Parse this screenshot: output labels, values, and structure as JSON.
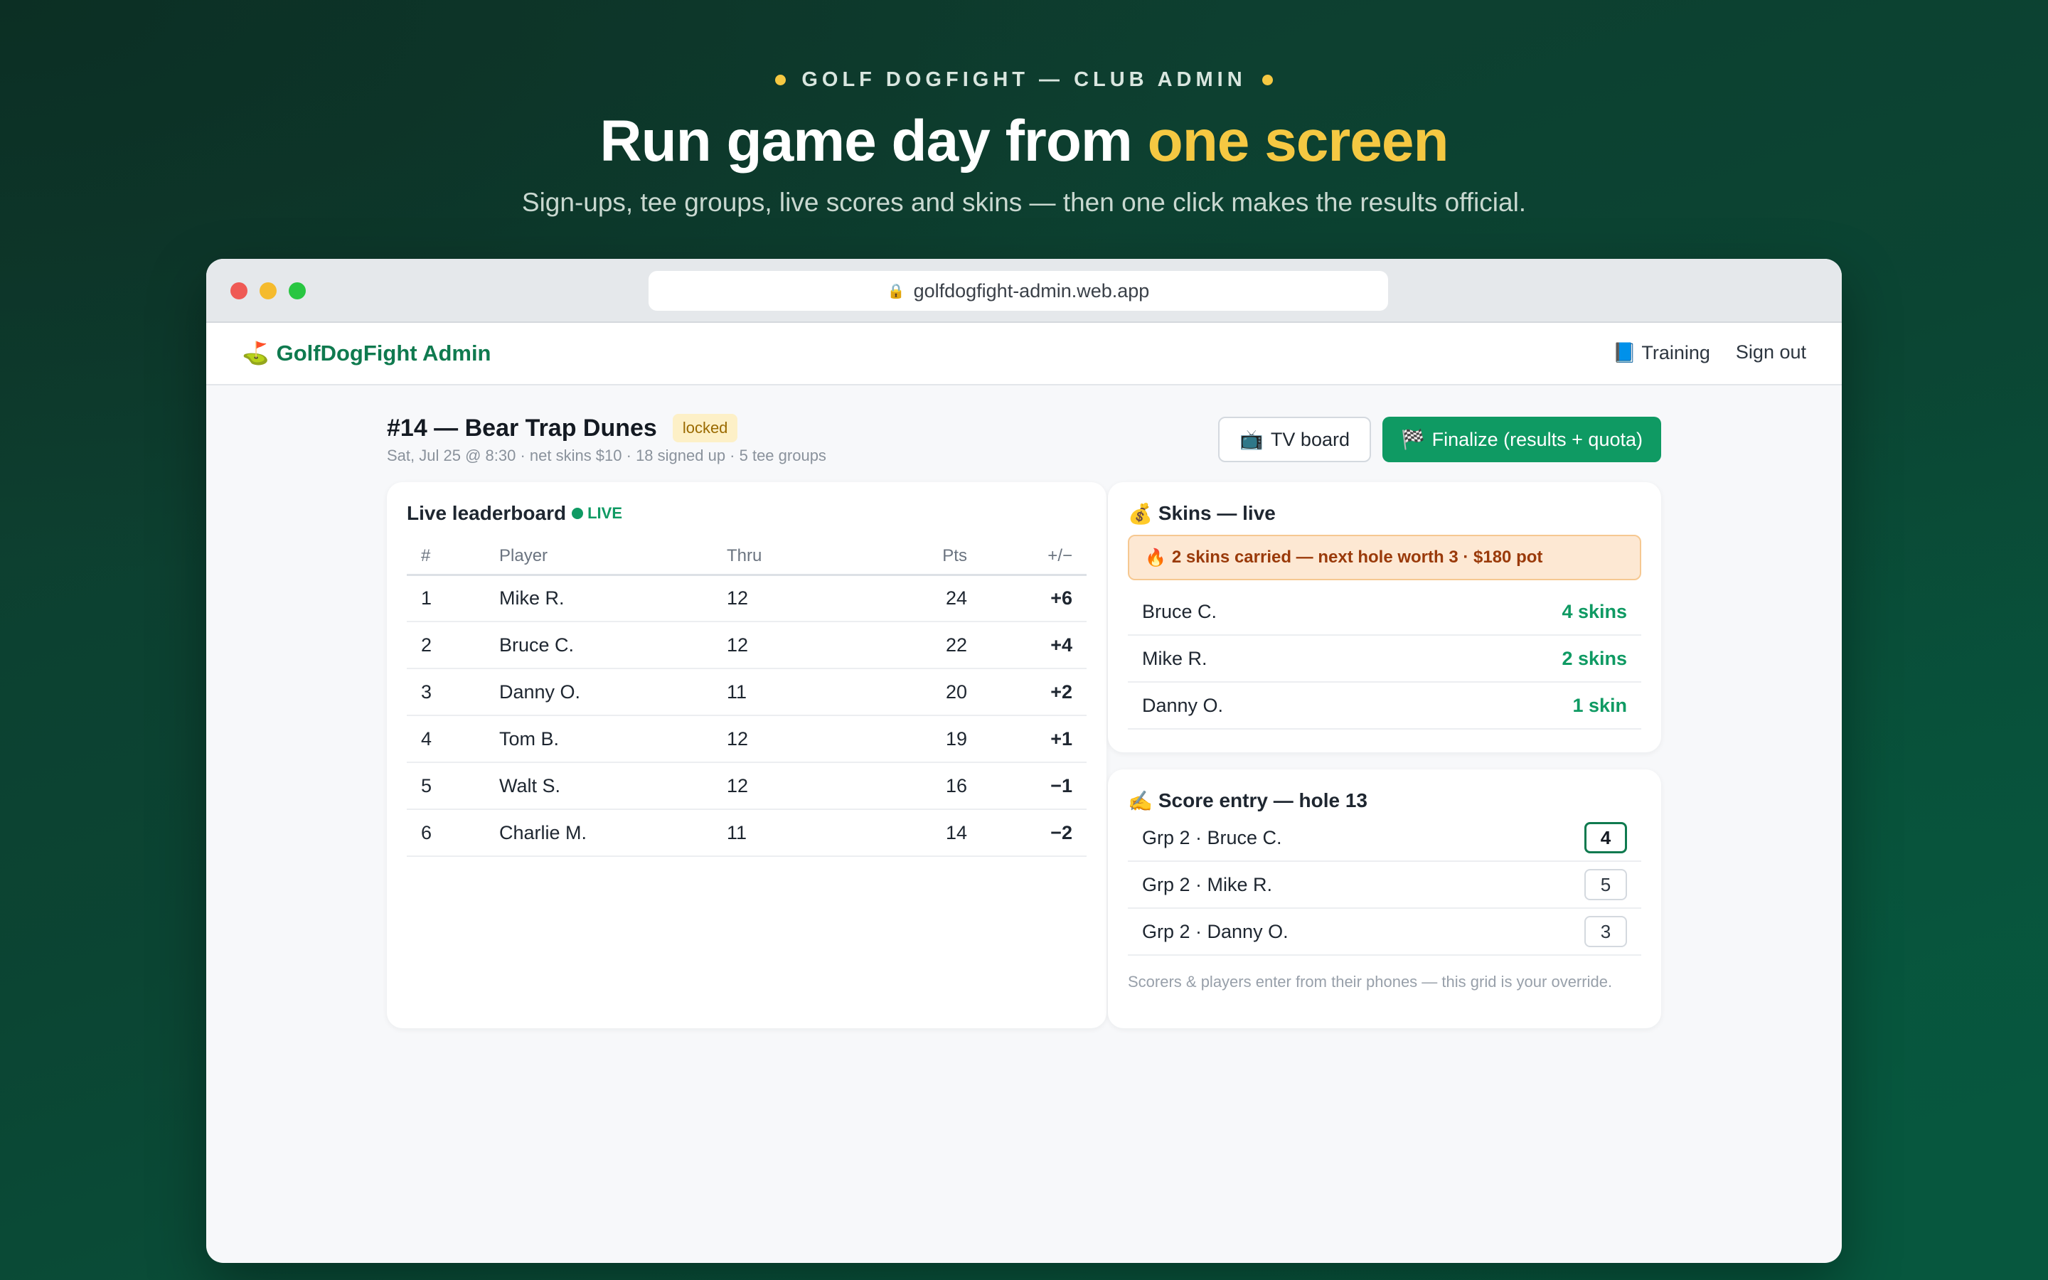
{
  "hero": {
    "eyebrow": "GOLF DOGFIGHT — CLUB ADMIN",
    "headline_main": "Run game day from ",
    "headline_accent": "one screen",
    "subhead": "Sign-ups, tee groups, live scores and skins — then one click makes the results official."
  },
  "browser": {
    "url": "golfdogfight-admin.web.app"
  },
  "nav": {
    "brand_icon": "⛳",
    "brand": "GolfDogFight Admin",
    "training_icon": "📘",
    "training": "Training",
    "sign_out": "Sign out"
  },
  "round": {
    "title": "#14 — Bear Trap Dunes",
    "status": "locked",
    "meta": "Sat, Jul 25 @ 8:30 · net skins $10 · 18 signed up · 5 tee groups",
    "tv_icon": "📺",
    "tv_label": "TV board",
    "finalize_icon": "🏁",
    "finalize_label": "Finalize (results + quota)"
  },
  "leaderboard": {
    "title": "Live leaderboard",
    "live_label": "LIVE",
    "columns": [
      "#",
      "Player",
      "Thru",
      "Pts",
      "+/−"
    ],
    "rows": [
      {
        "rank": "1",
        "player": "Mike R.",
        "thru": "12",
        "pts": "24",
        "diff": "+6"
      },
      {
        "rank": "2",
        "player": "Bruce C.",
        "thru": "12",
        "pts": "22",
        "diff": "+4"
      },
      {
        "rank": "3",
        "player": "Danny O.",
        "thru": "11",
        "pts": "20",
        "diff": "+2"
      },
      {
        "rank": "4",
        "player": "Tom B.",
        "thru": "12",
        "pts": "19",
        "diff": "+1"
      },
      {
        "rank": "5",
        "player": "Walt S.",
        "thru": "12",
        "pts": "16",
        "diff": "−1"
      },
      {
        "rank": "6",
        "player": "Charlie M.",
        "thru": "11",
        "pts": "14",
        "diff": "−2"
      }
    ]
  },
  "skins": {
    "icon": "💰",
    "title": "Skins — live",
    "carry_icon": "🔥",
    "carry": "2 skins carried — next hole worth 3 · $180 pot",
    "rows": [
      {
        "player": "Bruce C.",
        "count": "4 skins"
      },
      {
        "player": "Mike R.",
        "count": "2 skins"
      },
      {
        "player": "Danny O.",
        "count": "1 skin"
      }
    ]
  },
  "score_entry": {
    "icon": "✍️",
    "title": "Score entry — hole 13",
    "rows": [
      {
        "label": "Grp 2 · Bruce C.",
        "score": "4",
        "active": true
      },
      {
        "label": "Grp 2 · Mike R.",
        "score": "5",
        "active": false
      },
      {
        "label": "Grp 2 · Danny O.",
        "score": "3",
        "active": false
      }
    ],
    "note": "Scorers & players enter from their phones — this grid is your override."
  },
  "colors": {
    "brand_green": "#0f7a4f",
    "accent_yellow": "#f5c842",
    "positive": "#0f9a63",
    "negative": "#d32f2f"
  }
}
